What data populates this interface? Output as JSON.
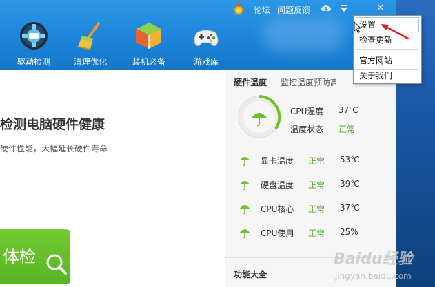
{
  "topbar": {
    "forum": "论坛",
    "feedback": "问题反馈",
    "icons": [
      "medal-icon",
      "cloud-download-icon",
      "menu-dropdown-icon",
      "minimize-icon",
      "close-icon"
    ],
    "minimize": "–",
    "close": "✕"
  },
  "nav": [
    {
      "label": "驱动检测",
      "icon": "driver-gear-icon"
    },
    {
      "label": "清理优化",
      "icon": "broom-icon"
    },
    {
      "label": "装机必备",
      "icon": "box-icon"
    },
    {
      "label": "游戏库",
      "icon": "gamepad-icon"
    }
  ],
  "main": {
    "title": "检测电脑硬件健康",
    "subtitle": "硬件性能，大幅延长硬件寿命",
    "check_button": "体检"
  },
  "hardware": {
    "heading": "硬件温度",
    "link": "监控温度预防高",
    "cpu_temp_label": "CPU温度",
    "cpu_temp_value": "37℃",
    "temp_status_label": "温度状态",
    "temp_status_value": "正常",
    "rows": [
      {
        "label": "显卡温度",
        "status": "正常",
        "value": "53℃"
      },
      {
        "label": "硬盘温度",
        "status": "正常",
        "value": "39℃"
      },
      {
        "label": "CPU核心",
        "status": "正常",
        "value": "37℃"
      },
      {
        "label": "CPU使用",
        "status": "正常",
        "value": "25%"
      }
    ],
    "footer": "功能大全"
  },
  "menu": {
    "items": [
      "设置",
      "检查更新",
      "官方网站",
      "关于我们"
    ]
  },
  "watermark": {
    "brand": "Baidu经验",
    "site": "jingyan.baidu.com"
  },
  "colors": {
    "header": "#1b83d9",
    "accent_green": "#58b520",
    "status_green": "#54a82a",
    "arrow_red": "#e02020"
  }
}
